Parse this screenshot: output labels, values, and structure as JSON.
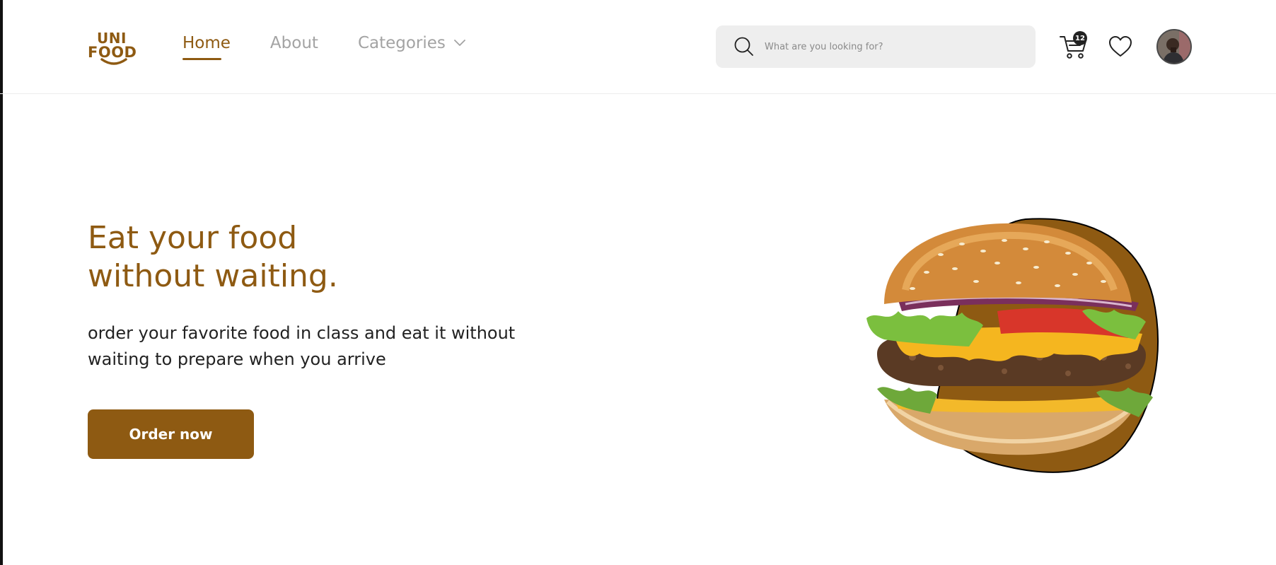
{
  "brand": {
    "logo_line1": "UNI",
    "logo_line2": "FOOD",
    "accent_color": "#8e5a12"
  },
  "nav": {
    "items": [
      {
        "label": "Home",
        "active": true
      },
      {
        "label": "About",
        "active": false
      },
      {
        "label": "Categories",
        "active": false,
        "icon": "chevron-down-icon"
      }
    ]
  },
  "search": {
    "placeholder": "What are you looking for?",
    "icon": "search-icon"
  },
  "header_actions": {
    "cart_icon": "cart-icon",
    "cart_count": "12",
    "wishlist_icon": "heart-icon",
    "avatar_icon": "user-avatar"
  },
  "hero": {
    "title_line1": "Eat your food",
    "title_line2": "without waiting.",
    "subtitle_line1": "order your favorite food in class and eat it without",
    "subtitle_line2": "waiting to prepare when you arrive",
    "cta_label": "Order now",
    "image": "burger-image"
  }
}
